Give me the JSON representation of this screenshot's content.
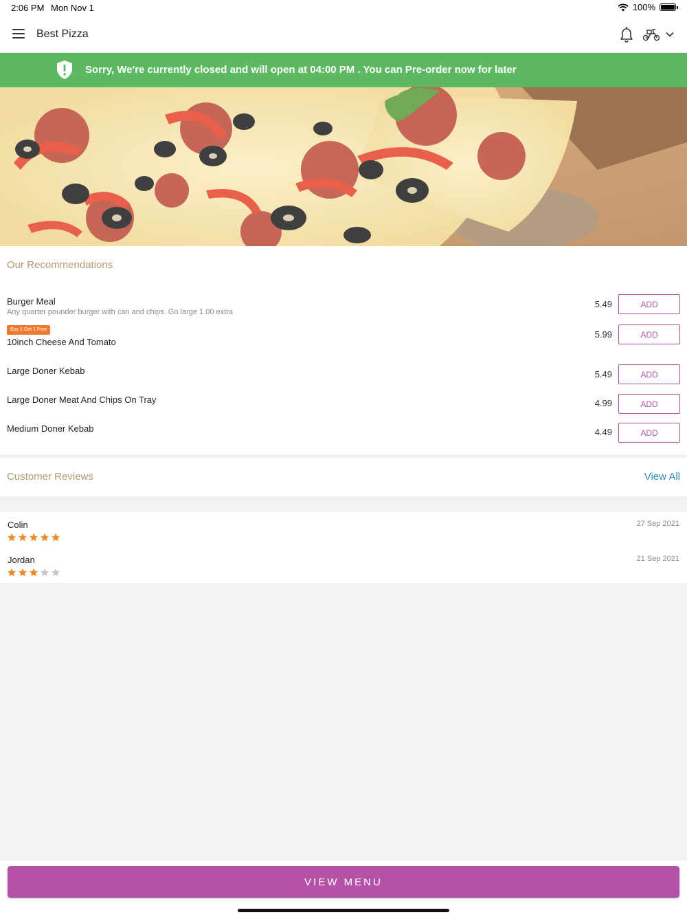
{
  "status_bar": {
    "time": "2:06 PM",
    "date": "Mon Nov 1",
    "battery": "100%"
  },
  "header": {
    "title": "Best Pizza",
    "icons": [
      "menu-icon",
      "bell-icon",
      "scooter-icon",
      "chevron-down-icon"
    ]
  },
  "banner": {
    "message": "Sorry, We're currently closed and will open at 04:00 PM . You can Pre-order now for later",
    "color": "#5cb961"
  },
  "recommendations": {
    "title": "Our Recommendations",
    "add_label": "ADD",
    "items": [
      {
        "name": "Burger Meal",
        "description": "Any quarter pounder burger with can and chips. Go large 1.00 extra",
        "badge": "",
        "price": "5.49"
      },
      {
        "name": "10inch Cheese And Tomato",
        "description": "",
        "badge": "Buy 1 Get 1 Free",
        "price": "5.99"
      },
      {
        "name": "Large Doner Kebab",
        "description": "",
        "badge": "",
        "price": "5.49"
      },
      {
        "name": "Large Doner Meat And Chips On Tray",
        "description": "",
        "badge": "",
        "price": "4.99"
      },
      {
        "name": "Medium Doner Kebab",
        "description": "",
        "badge": "",
        "price": "4.49"
      }
    ]
  },
  "reviews": {
    "title": "Customer Reviews",
    "view_all": "View All",
    "items": [
      {
        "name": "Colin",
        "date": "27 Sep 2021",
        "rating": 5,
        "max_rating": 5
      },
      {
        "name": "Jordan",
        "date": "21 Sep 2021",
        "rating": 3,
        "max_rating": 5
      }
    ]
  },
  "bottom": {
    "view_menu": "VIEW MENU"
  },
  "colors": {
    "accent": "#b452a6",
    "star_on": "#f08a24",
    "star_off": "#c8c8c8",
    "link": "#2f8fb0",
    "section_title": "#b09a74"
  }
}
